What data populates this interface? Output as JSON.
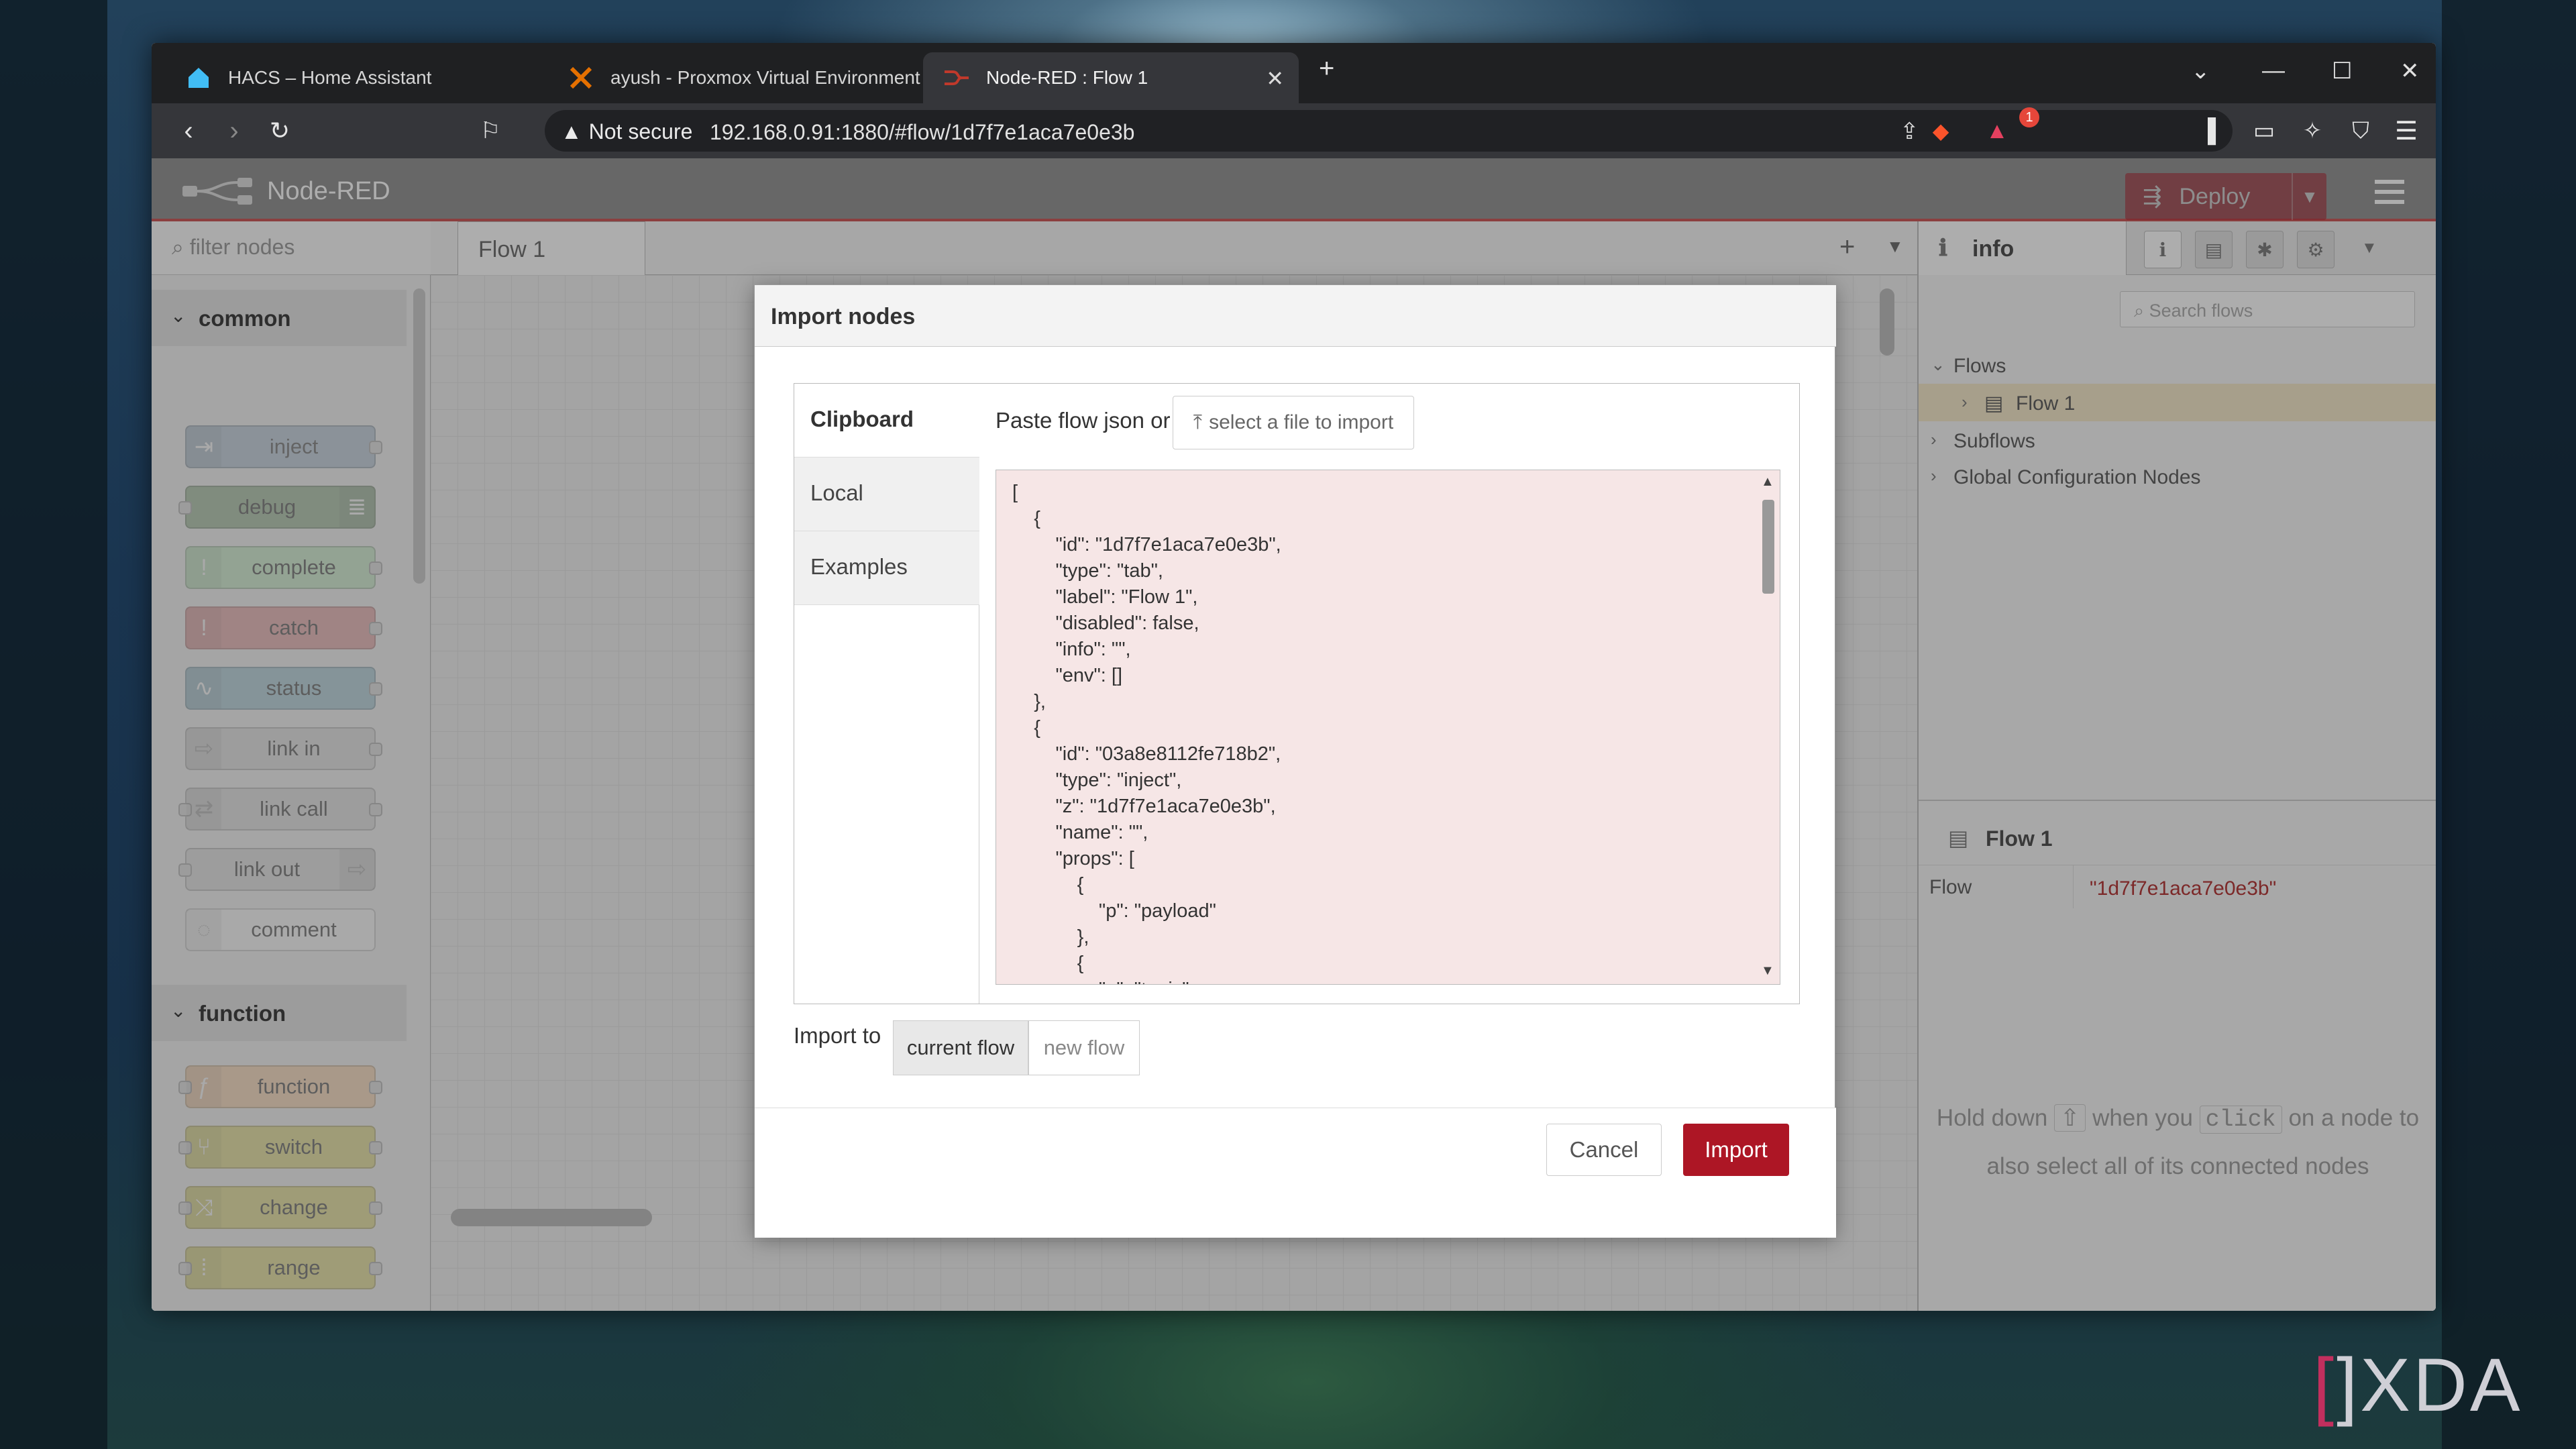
{
  "browser": {
    "tabs": [
      {
        "title": "HACS – Home Assistant"
      },
      {
        "title": "ayush - Proxmox Virtual Environment"
      },
      {
        "title": "Node-RED : Flow 1"
      }
    ],
    "security_label": "Not secure",
    "url": "192.168.0.91:1880/#flow/1d7f7e1aca7e0e3b",
    "alert_badge": "1"
  },
  "app": {
    "name": "Node-RED",
    "deploy_label": "Deploy"
  },
  "palette": {
    "filter_placeholder": "filter nodes",
    "categories": [
      {
        "label": "common",
        "nodes": [
          "inject",
          "debug",
          "complete",
          "catch",
          "status",
          "link in",
          "link call",
          "link out",
          "comment"
        ]
      },
      {
        "label": "function",
        "nodes": [
          "function",
          "switch",
          "change",
          "range"
        ]
      }
    ]
  },
  "workspace": {
    "tab_label": "Flow 1"
  },
  "sidebar": {
    "tab_label": "info",
    "search_placeholder": "Search flows",
    "tree": [
      "Flows",
      "Flow 1",
      "Subflows",
      "Global Configuration Nodes"
    ],
    "details_title": "Flow 1",
    "details_key": "Flow",
    "details_value": "\"1d7f7e1aca7e0e3b\"",
    "tip_parts": [
      "Hold down",
      "when you",
      "click",
      "on a",
      "node to also select all of its connected",
      "nodes"
    ]
  },
  "dialog": {
    "title": "Import nodes",
    "tabs": [
      "Clipboard",
      "Local",
      "Examples"
    ],
    "paste_label": "Paste flow json or",
    "file_button": "select a file to import",
    "code": "[\n    {\n        \"id\": \"1d7f7e1aca7e0e3b\",\n        \"type\": \"tab\",\n        \"label\": \"Flow 1\",\n        \"disabled\": false,\n        \"info\": \"\",\n        \"env\": []\n    },\n    {\n        \"id\": \"03a8e8112fe718b2\",\n        \"type\": \"inject\",\n        \"z\": \"1d7f7e1aca7e0e3b\",\n        \"name\": \"\",\n        \"props\": [\n            {\n                \"p\": \"payload\"\n            },\n            {\n                \"p\": \"topic\",",
    "import_to_label": "Import to",
    "import_to_options": [
      "current flow",
      "new flow"
    ],
    "cancel_label": "Cancel",
    "import_label": "Import"
  },
  "watermark": "XDA",
  "colors": {
    "accent": "#ad1625",
    "header": "#8f8f8f"
  }
}
